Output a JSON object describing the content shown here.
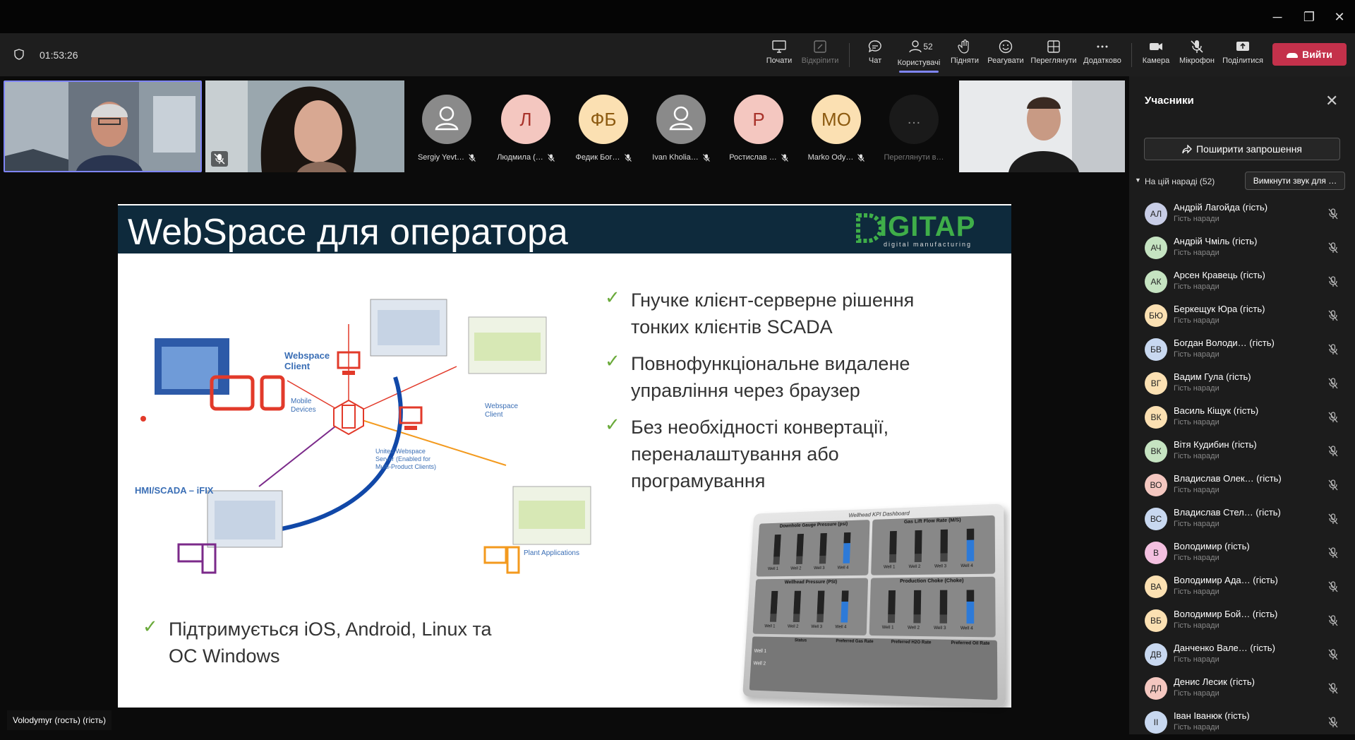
{
  "window": {
    "minimize": "─",
    "restore": "❐",
    "close": "✕"
  },
  "toolbar": {
    "timer": "01:53:26",
    "buttons": {
      "share": "Почати",
      "record": "Відкріпити",
      "chat": "Чат",
      "people": "Користувачі",
      "people_count": "52",
      "raise": "Підняти",
      "react": "Реагувати",
      "view": "Переглянути",
      "more": "Додатково",
      "camera": "Камера",
      "mic": "Мікрофон",
      "share_screen": "Поділитися",
      "leave": "Вийти"
    }
  },
  "stage": {
    "participants": [
      {
        "initials": "",
        "name": "Sergiy Yevt…",
        "bg": "#8a8a8a",
        "fg": "#ffffff",
        "person": true
      },
      {
        "initials": "Л",
        "name": "Людмила (…",
        "bg": "#f4c7c0",
        "fg": "#a8322a",
        "person": false
      },
      {
        "initials": "ФБ",
        "name": "Федик Бог…",
        "bg": "#fbe0b2",
        "fg": "#8c5a10",
        "person": false
      },
      {
        "initials": "",
        "name": "Ivan Kholia…",
        "bg": "#8a8a8a",
        "fg": "#ffffff",
        "person": true
      },
      {
        "initials": "Р",
        "name": "Ростислав …",
        "bg": "#f4c7c0",
        "fg": "#a8322a",
        "person": false
      },
      {
        "initials": "МО",
        "name": "Marko Ody…",
        "bg": "#fbe0b2",
        "fg": "#8c5a10",
        "person": false
      }
    ],
    "more_label": "Переглянути в…",
    "more_icon": "…",
    "nameplate": "Volodymyr (гость) (гість)"
  },
  "slide": {
    "title": "WebSpace для оператора",
    "logo": "IGITAP",
    "logo_sub": "digital manufacturing",
    "bullets": [
      [
        "Гнучке клієнт-серверне рішення",
        "тонких клієнтів SCADA"
      ],
      [
        "Повнофункціональне видалене",
        "управління через браузер"
      ],
      [
        "Без необхідності конвертації,",
        "переналаштування або",
        "програмування"
      ]
    ],
    "bottom_bullet": [
      "Підтримується iOS, Android, Linux та",
      "ОС Windows"
    ],
    "diagram": {
      "webspace_client": [
        "Webspace",
        "Client"
      ],
      "mobile": [
        "Mobile",
        "Devices"
      ],
      "webspace_client2": [
        "Webspace",
        "Client"
      ],
      "server": [
        "United Webspace",
        "Server (Enabled for",
        "Multi-Product Clients)"
      ],
      "hmi": "HMI/SCADA – iFIX",
      "plant": "Plant Applications"
    },
    "dashboard": {
      "title": "Wellhead KPI Dashboard",
      "panels": [
        "Downhole Gauge Pressure (psi)",
        "Gas Lift Flow Rate (M/S)",
        "Wellhead Pressure (PSI)",
        "Production Choke (Choke)"
      ],
      "wells": [
        "Well 1",
        "Well 2",
        "Well 3",
        "Well 4"
      ],
      "table_headers": [
        "Status",
        "Preferred Gas Rate",
        "Preferred H2O Rate",
        "Preferred Oil Rate"
      ],
      "rows": [
        "Well 1",
        "Well 2"
      ]
    }
  },
  "panel": {
    "title": "Учасники",
    "close": "✕",
    "invite": "Поширити запрошення",
    "section": "На цій нараді (52)",
    "mute_all": "Вимкнути звук для …",
    "people": [
      {
        "initials": "АЛ",
        "name": "Андрій Лагойда (гість)",
        "sub": "Гість наради",
        "color": "#c8cde6"
      },
      {
        "initials": "АЧ",
        "name": "Андрій Чміль (гість)",
        "sub": "Гість наради",
        "color": "#c5e3c1"
      },
      {
        "initials": "АК",
        "name": "Арсен Кравець (гість)",
        "sub": "Гість наради",
        "color": "#c5e3c1"
      },
      {
        "initials": "БЮ",
        "name": "Беркещук Юра (гість)",
        "sub": "Гість наради",
        "color": "#fbe0b2"
      },
      {
        "initials": "БВ",
        "name": "Богдан Володи…  (гість)",
        "sub": "Гість наради",
        "color": "#c8d8f0"
      },
      {
        "initials": "ВГ",
        "name": "Вадим Гула (гість)",
        "sub": "Гість наради",
        "color": "#fbe0b2"
      },
      {
        "initials": "ВК",
        "name": "Василь Кіщук (гість)",
        "sub": "Гість наради",
        "color": "#fbe0b2"
      },
      {
        "initials": "ВК",
        "name": "Вітя Кудибин (гість)",
        "sub": "Гість наради",
        "color": "#c5e3c1"
      },
      {
        "initials": "ВО",
        "name": "Владислав Олек…  (гість)",
        "sub": "Гість наради",
        "color": "#f4c7c0"
      },
      {
        "initials": "ВС",
        "name": "Владислав Стел…  (гість)",
        "sub": "Гість наради",
        "color": "#c8d8f0"
      },
      {
        "initials": "В",
        "name": "Володимир (гість)",
        "sub": "Гість наради",
        "color": "#f4c0e0"
      },
      {
        "initials": "ВА",
        "name": "Володимир Ада…  (гість)",
        "sub": "Гість наради",
        "color": "#fbe0b2"
      },
      {
        "initials": "ВБ",
        "name": "Володимир Бой…  (гість)",
        "sub": "Гість наради",
        "color": "#fbe0b2"
      },
      {
        "initials": "ДВ",
        "name": "Данченко Вале…  (гість)",
        "sub": "Гість наради",
        "color": "#c8d8f0"
      },
      {
        "initials": "ДЛ",
        "name": "Денис Лесик (гість)",
        "sub": "Гість наради",
        "color": "#f4c7c0"
      },
      {
        "initials": "ІІ",
        "name": "Іван Іванюк (гість)",
        "sub": "Гість наради",
        "color": "#c8d8f0"
      }
    ]
  },
  "colors": {
    "accent": "#7f85f5",
    "leave": "#c4314b",
    "slide_header": "#0e2a3c",
    "check": "#6aaa3a",
    "red": "#e23a2a",
    "purple": "#7b2a8a",
    "orange": "#f39a1e",
    "blue": "#1148a8"
  }
}
